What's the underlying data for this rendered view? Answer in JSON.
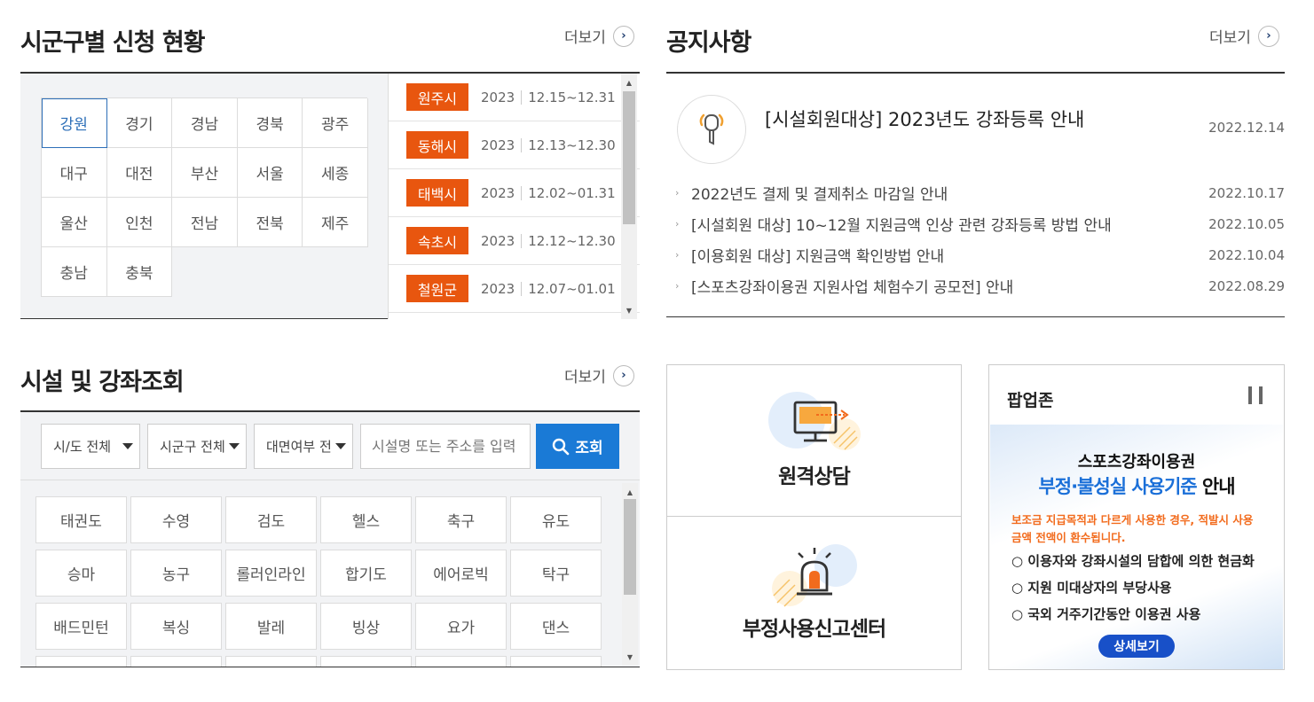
{
  "region": {
    "title": "시군구별 신청 현황",
    "more": "더보기",
    "regions": [
      "강원",
      "경기",
      "경남",
      "경북",
      "광주",
      "대구",
      "대전",
      "부산",
      "서울",
      "세종",
      "울산",
      "인천",
      "전남",
      "전북",
      "제주",
      "충남",
      "충북"
    ],
    "applications": [
      {
        "city": "원주시",
        "year": "2023",
        "period": "12.15~12.31"
      },
      {
        "city": "동해시",
        "year": "2023",
        "period": "12.13~12.30"
      },
      {
        "city": "태백시",
        "year": "2023",
        "period": "12.02~01.31"
      },
      {
        "city": "속초시",
        "year": "2023",
        "period": "12.12~12.30"
      },
      {
        "city": "철원군",
        "year": "2023",
        "period": "12.07~01.01"
      }
    ]
  },
  "notice": {
    "title": "공지사항",
    "more": "더보기",
    "main": {
      "text": "[시설회원대상] 2023년도 강좌등록 안내",
      "date": "2022.12.14"
    },
    "items": [
      {
        "text": "2022년도 결제 및 결제취소 마감일 안내",
        "date": "2022.10.17"
      },
      {
        "text": "[시설회원 대상] 10~12월 지원금액 인상 관련 강좌등록 방법 안내",
        "date": "2022.10.05"
      },
      {
        "text": "[이용회원 대상] 지원금액 확인방법 안내",
        "date": "2022.10.04"
      },
      {
        "text": "[스포츠강좌이용권 지원사업 체험수기 공모전] 안내",
        "date": "2022.08.29"
      }
    ]
  },
  "facility": {
    "title": "시설 및 강좌조회",
    "more": "더보기",
    "select_sido": "시/도 전체",
    "select_sigungu": "시군구 전체",
    "select_face": "대면여부 전체",
    "search_placeholder": "시설명 또는 주소를 입력",
    "search_button": "조회",
    "sports": [
      "태권도",
      "수영",
      "검도",
      "헬스",
      "축구",
      "유도",
      "승마",
      "농구",
      "롤러인라인",
      "합기도",
      "에어로빅",
      "탁구",
      "배드민턴",
      "복싱",
      "발레",
      "빙상",
      "요가",
      "댄스"
    ]
  },
  "services": {
    "remote": "원격상담",
    "report": "부정사용신고센터"
  },
  "popup": {
    "title": "팝업존",
    "banner_line1": "스포츠강좌이용권",
    "banner_line2a": "부정·불성실 사용기준",
    "banner_line2b": " 안내",
    "banner_warn1": "보조금 지급목적과 다르게 사용한 경우, 적발시 사용",
    "banner_warn2": "금액 전액이 환수됩니다.",
    "bullets": [
      "○ 이용자와 강좌시설의 담합에 의한 현금화",
      "○ 지원 미대상자의 부당사용",
      "○ 국외 거주기간동안 이용권 사용"
    ],
    "detail_button": "상세보기"
  },
  "colors": {
    "accent_orange": "#e8560f",
    "accent_blue": "#1a7ad6",
    "active_blue": "#2d6fb8"
  }
}
